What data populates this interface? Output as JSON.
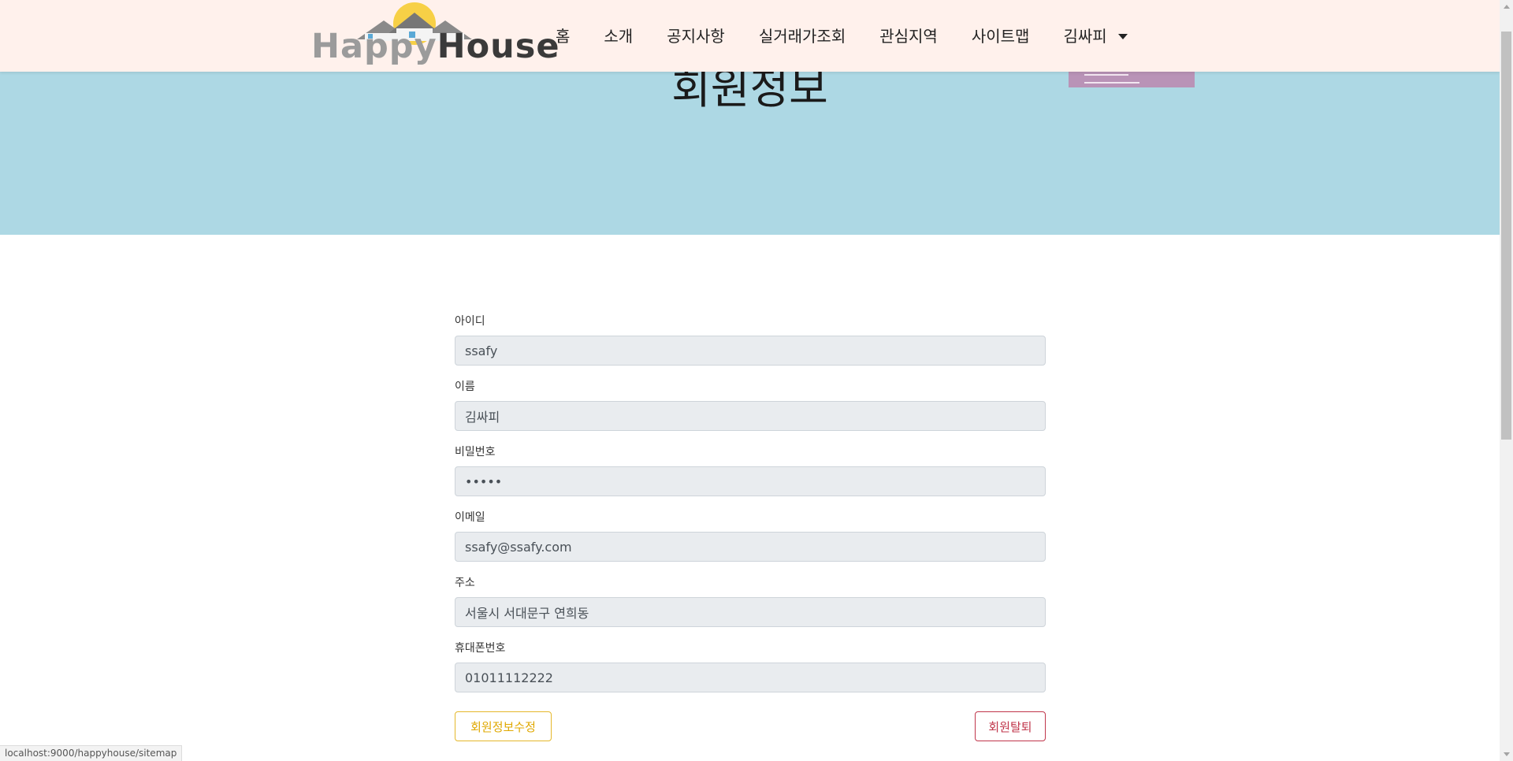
{
  "header": {
    "logo": {
      "word1": "Happy",
      "word2": "House"
    },
    "nav": [
      "홈",
      "소개",
      "공지사항",
      "실거래가조회",
      "관심지역",
      "사이트맵"
    ],
    "user_menu": "김싸피"
  },
  "hero": {
    "title": "회원정보"
  },
  "form": {
    "fields": [
      {
        "label": "아이디",
        "value": "ssafy"
      },
      {
        "label": "이름",
        "value": "김싸피"
      },
      {
        "label": "비밀번호",
        "value": "•••••"
      },
      {
        "label": "이메일",
        "value": "ssafy@ssafy.com"
      },
      {
        "label": "주소",
        "value": "서울시 서대문구 연희동"
      },
      {
        "label": "휴대폰번호",
        "value": "01011112222"
      }
    ],
    "update_button": "회원정보수정",
    "withdraw_button": "회원탈퇴"
  },
  "status_bar": {
    "url": "localhost:9000/happyhouse/sitemap"
  },
  "colors": {
    "navbar_bg": "#fff1ec",
    "hero_bg": "#add8e4",
    "input_bg": "#e9ecef",
    "warning": "#e0a800",
    "danger": "#c0364b",
    "logo_sun": "#f7d046",
    "dropdown_bg": "#b993b7"
  }
}
